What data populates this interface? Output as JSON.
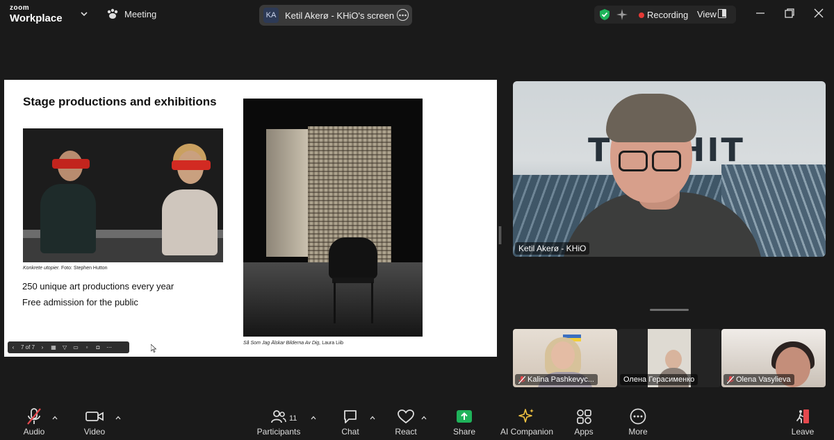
{
  "app": {
    "brand_top": "zoom",
    "brand_bottom": "Workplace",
    "meeting_label": "Meeting"
  },
  "share": {
    "initials": "KA",
    "label": "Ketil Akerø - KHiO's screen"
  },
  "status": {
    "recording": "Recording",
    "view": "View"
  },
  "slide": {
    "title": "Stage productions and exhibitions",
    "caption1_italic": "Konkrete utopier.",
    "caption1_rest": " Foto: Stephen Hutton",
    "bullet1": "250 unique art productions every year",
    "bullet2": "Free admission for the public",
    "caption2_italic": "Så Som Jag Älskar Bilderna Av Dig,",
    "caption2_rest": " Laura Liib",
    "page_indicator": "7 of 7"
  },
  "speaker": {
    "name": "Ketil Akerø - KHiO",
    "sign_text": "TU SHIT"
  },
  "participants_thumbs": [
    {
      "name": "Kalina Pashkevyc...",
      "muted": true
    },
    {
      "name": "Олена Герасименко",
      "muted": false
    },
    {
      "name": "Olena Vasylieva",
      "muted": true
    }
  ],
  "toolbar": {
    "audio": "Audio",
    "video": "Video",
    "participants": "Participants",
    "participants_count": "11",
    "chat": "Chat",
    "react": "React",
    "share": "Share",
    "ai_companion": "AI Companion",
    "apps": "Apps",
    "more": "More",
    "leave": "Leave"
  },
  "colors": {
    "share_green": "#1fb35a",
    "leave_red": "#e5484d",
    "recording_red": "#e53935",
    "ai_gold": "#f4c542",
    "shield_green": "#1fb35a"
  }
}
